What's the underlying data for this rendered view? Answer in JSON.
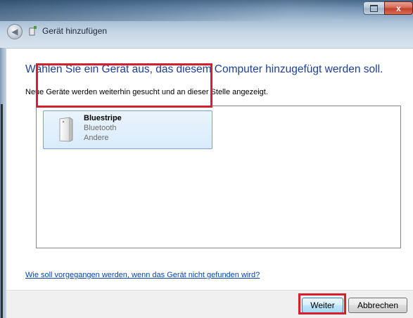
{
  "window": {
    "title": "Gerät hinzufügen",
    "close_label": "x"
  },
  "main": {
    "heading": "Wählen Sie ein Gerät aus, das diesem Computer hinzugefügt werden soll.",
    "subtext": "Neue Geräte werden weiterhin gesucht und an dieser Stelle angezeigt.",
    "devices": [
      {
        "name": "Bluestripe",
        "type": "Bluetooth",
        "category": "Andere",
        "icon": "device-icon",
        "selected": true
      }
    ],
    "help_link": "Wie soll vorgegangen werden, wenn das Gerät nicht gefunden wird?"
  },
  "footer": {
    "next_label": "Weiter",
    "cancel_label": "Abbrechen"
  },
  "colors": {
    "heading": "#1c3f94",
    "highlight": "#d3202c",
    "link": "#0645ad",
    "selection": "#d9ebfa"
  }
}
